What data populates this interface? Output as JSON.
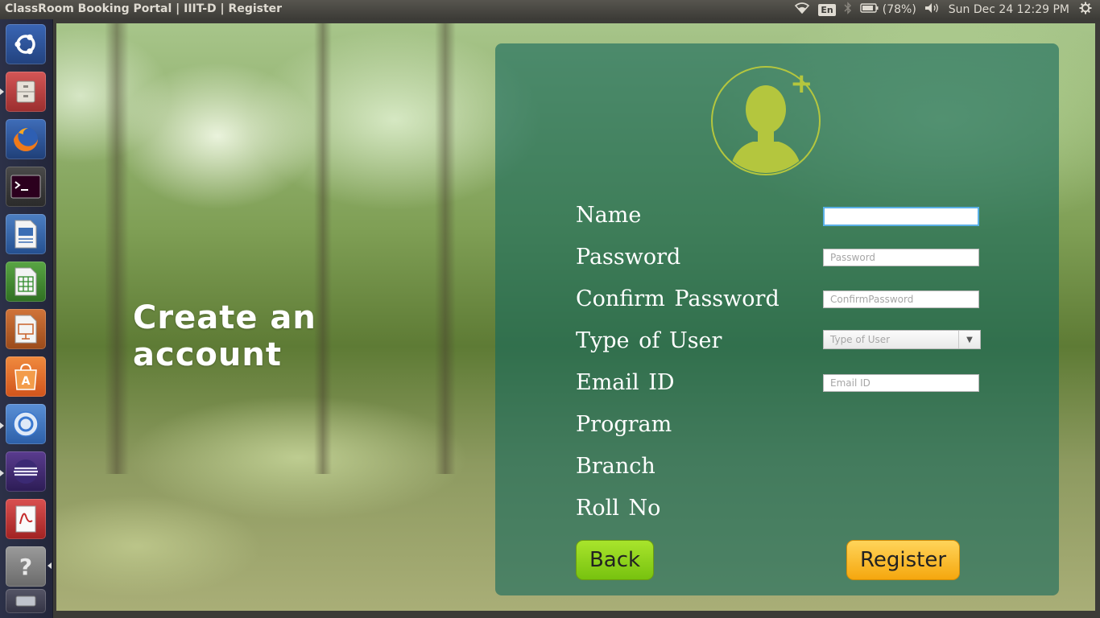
{
  "top_panel": {
    "window_title": "ClassRoom Booking Portal | IIIT-D | Register",
    "keyboard_layout": "En",
    "battery_percent": "(78%)",
    "datetime": "Sun Dec 24 12:29 PM"
  },
  "launcher": {
    "items": [
      {
        "name": "ubuntu-dash"
      },
      {
        "name": "files"
      },
      {
        "name": "firefox"
      },
      {
        "name": "terminal"
      },
      {
        "name": "libreoffice-writer"
      },
      {
        "name": "libreoffice-calc"
      },
      {
        "name": "libreoffice-impress"
      },
      {
        "name": "ubuntu-software-center"
      },
      {
        "name": "chromium"
      },
      {
        "name": "eclipse"
      },
      {
        "name": "document-viewer"
      },
      {
        "name": "help"
      },
      {
        "name": "removable-drive"
      }
    ]
  },
  "page": {
    "heading": "Create an account"
  },
  "form": {
    "labels": {
      "name": "Name",
      "password": "Password",
      "confirm_password": "Confirm  Password",
      "type_of_user": "Type  of  User",
      "email": "Email  ID",
      "program": "Program",
      "branch": "Branch",
      "roll_no": "Roll  No"
    },
    "placeholders": {
      "password": "Password",
      "confirm_password": "ConfirmPassword",
      "type_of_user": "Type of User",
      "email": "Email ID"
    },
    "values": {
      "name": ""
    },
    "buttons": {
      "back": "Back",
      "register": "Register"
    }
  },
  "colors": {
    "card": "#16695c",
    "avatar_accent": "#b4c63e",
    "back_button": "#8fd21e",
    "register_button": "#f9b81f"
  }
}
